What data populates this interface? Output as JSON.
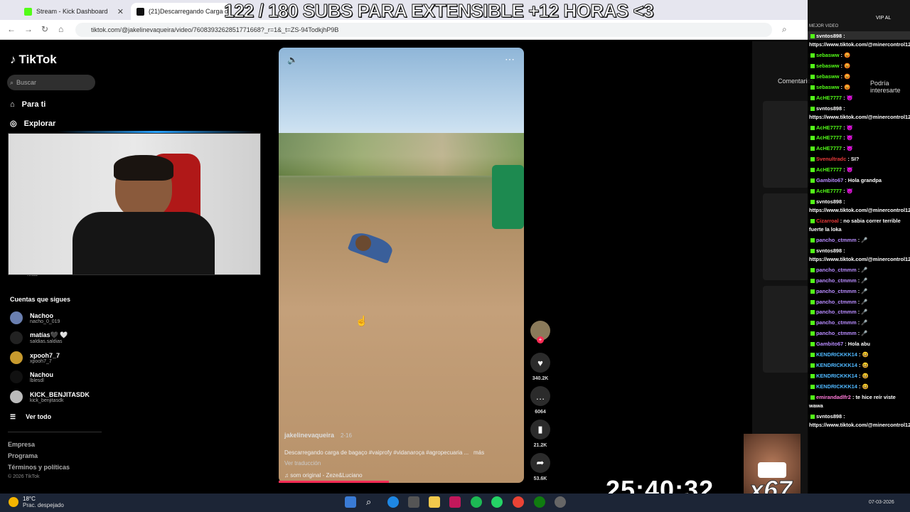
{
  "browser": {
    "tabs": [
      {
        "title": "Stream - Kick Dashboard",
        "active": false
      },
      {
        "title": "(21)Descarregando Carga de B",
        "active": true
      }
    ],
    "url": "tiktok.com/@jakelinevaqueira/video/7608393262851771668?_r=1&_t=ZS-94TodkjhP9B"
  },
  "banner": "122 / 180 SUBS PARA EXTENSIBLE +12 HORAS <3",
  "sidebar": {
    "logo": "TikTok",
    "search_placeholder": "Buscar",
    "nav": [
      {
        "label": "Para ti",
        "icon": "home-icon"
      },
      {
        "label": "Explorar",
        "icon": "compass-icon"
      }
    ],
    "partial_label": "Más",
    "following_title": "Cuentas que sigues",
    "accounts": [
      {
        "name": "Nachoo",
        "handle": "nacho_0_019"
      },
      {
        "name": "matías🖤 🤍",
        "handle": "saldias.saldias"
      },
      {
        "name": "xpooh7_7",
        "handle": "xpooh7_7"
      },
      {
        "name": "Nachou",
        "handle": "lblesdl"
      },
      {
        "name": "KICK_BENJITASDK",
        "handle": "kick_benjitasdk"
      }
    ],
    "see_all": "Ver todo",
    "footer": [
      "Empresa",
      "Programa",
      "Términos y políticas"
    ],
    "copyright": "© 2026 TikTok"
  },
  "video": {
    "username": "jakelinevaqueira",
    "date": "2-16",
    "description": "Descarregando carga de bagaço #vaiprofy #vidanaroça #agropecuaria ...",
    "more": "más",
    "translation": "Ver traducción",
    "sound": "som original - Zeze&Luciano"
  },
  "actions": {
    "likes": "340.2K",
    "comments": "6064",
    "saves": "21.2K",
    "shares": "53.6K"
  },
  "right_panel": {
    "tab_comments": "Comentarios",
    "tab_maybe": "Podría interesarte"
  },
  "chat_header": {
    "label": "VIP AL",
    "sub": "MEJOR VIDEO"
  },
  "chat": [
    {
      "user": "svntos898",
      "text": "https://www.tiktok.com/@minercontrol12/video/7577576232913620245",
      "color": "#ffffff",
      "wrap": true
    },
    {
      "user": "sebasww",
      "text": "😡",
      "color": "#53fc18"
    },
    {
      "user": "sebasww",
      "text": "😡",
      "color": "#53fc18"
    },
    {
      "user": "sebasww",
      "text": "😡",
      "color": "#53fc18"
    },
    {
      "user": "sebasww",
      "text": "😡",
      "color": "#53fc18"
    },
    {
      "user": "AcHE7777",
      "text": "😈",
      "color": "#53fc18"
    },
    {
      "user": "svntos898",
      "text": "https://www.tiktok.com/@minercontrol12/video/7577576232913620245",
      "color": "#ffffff",
      "wrap": true
    },
    {
      "user": "AcHE7777",
      "text": "😈",
      "color": "#53fc18"
    },
    {
      "user": "AcHE7777",
      "text": "😈",
      "color": "#53fc18"
    },
    {
      "user": "AcHE7777",
      "text": "😈",
      "color": "#53fc18"
    },
    {
      "user": "Svenultradc",
      "text": "SI?",
      "color": "#e83a3a"
    },
    {
      "user": "AcHE7777",
      "text": "😈",
      "color": "#53fc18"
    },
    {
      "user": "Gambito67",
      "text": "Hola grandpa",
      "color": "#b88cff"
    },
    {
      "user": "AcHE7777",
      "text": "😈",
      "color": "#53fc18"
    },
    {
      "user": "svntos898",
      "text": "https://www.tiktok.com/@minercontrol12/video/7577576232913620245",
      "color": "#ffffff",
      "wrap": true
    },
    {
      "user": "Cizarroal",
      "text": "no sabia correr terrible fuerte la loka",
      "color": "#e83a3a",
      "wrap": true
    },
    {
      "user": "pancho_ctmmm",
      "text": "🎤",
      "color": "#b88cff"
    },
    {
      "user": "svntos898",
      "text": "https://www.tiktok.com/@minercontrol12/video/7577576232913620245",
      "color": "#ffffff",
      "wrap": true
    },
    {
      "user": "pancho_ctmmm",
      "text": "🎤",
      "color": "#b88cff"
    },
    {
      "user": "pancho_ctmmm",
      "text": "🎤",
      "color": "#b88cff"
    },
    {
      "user": "pancho_ctmmm",
      "text": "🎤",
      "color": "#b88cff"
    },
    {
      "user": "pancho_ctmmm",
      "text": "🎤",
      "color": "#b88cff"
    },
    {
      "user": "pancho_ctmmm",
      "text": "🎤",
      "color": "#b88cff"
    },
    {
      "user": "pancho_ctmmm",
      "text": "🎤",
      "color": "#b88cff"
    },
    {
      "user": "pancho_ctmmm",
      "text": "🎤",
      "color": "#b88cff"
    },
    {
      "user": "Gambito67",
      "text": "Hola abu",
      "color": "#b88cff"
    },
    {
      "user": "KENDRICKKK14",
      "text": "😆",
      "color": "#4fb8ff"
    },
    {
      "user": "KENDRICKKK14",
      "text": "😆",
      "color": "#4fb8ff"
    },
    {
      "user": "KENDRICKKK14",
      "text": "😆",
      "color": "#4fb8ff"
    },
    {
      "user": "KENDRICKKK14",
      "text": "😆",
      "color": "#4fb8ff"
    },
    {
      "user": "emirandadlfr2",
      "text": "te hice reír viste wawa",
      "color": "#ff7ad9",
      "wrap": true
    },
    {
      "user": "svntos898",
      "text": "https://www.tiktok.com/@minercontrol12/video/7577576232913620245",
      "color": "#ffffff",
      "wrap": true
    }
  ],
  "overlay": {
    "timer": "25:40:32",
    "multiplier": "x67"
  },
  "taskbar": {
    "temp": "18°C",
    "condition": "Prac. despejado",
    "date": "07-03-2026"
  }
}
